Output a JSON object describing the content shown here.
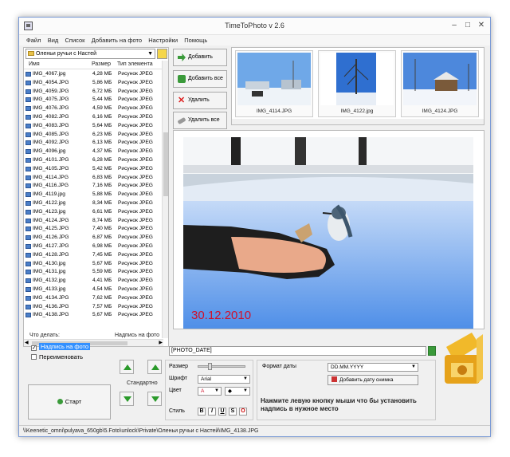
{
  "window": {
    "title": "TimeToPhoto v 2.6",
    "minimize": "–",
    "maximize": "□",
    "close": "✕"
  },
  "menu": [
    "Файл",
    "Вид",
    "Список",
    "Добавить на фото",
    "Настройки",
    "Помощь"
  ],
  "folder": {
    "current": "Оленьи ручьи с Настей"
  },
  "columns": {
    "name": "Имя",
    "size": "Размер",
    "type": "Тип элемента"
  },
  "files": [
    {
      "name": "IMG_4067.jpg",
      "size": "4,28 МБ",
      "type": "Рисунок JPEG"
    },
    {
      "name": "IMG_4054.JPG",
      "size": "5,86 МБ",
      "type": "Рисунок JPEG"
    },
    {
      "name": "IMG_4059.JPG",
      "size": "6,72 МБ",
      "type": "Рисунок JPEG"
    },
    {
      "name": "IMG_4075.JPG",
      "size": "5,44 МБ",
      "type": "Рисунок JPEG"
    },
    {
      "name": "IMG_4076.JPG",
      "size": "4,59 МБ",
      "type": "Рисунок JPEG"
    },
    {
      "name": "IMG_4082.JPG",
      "size": "6,16 МБ",
      "type": "Рисунок JPEG"
    },
    {
      "name": "IMG_4083.JPG",
      "size": "5,64 МБ",
      "type": "Рисунок JPEG"
    },
    {
      "name": "IMG_4085.JPG",
      "size": "6,23 МБ",
      "type": "Рисунок JPEG"
    },
    {
      "name": "IMG_4092.JPG",
      "size": "6,13 МБ",
      "type": "Рисунок JPEG"
    },
    {
      "name": "IMG_4096.jpg",
      "size": "4,37 МБ",
      "type": "Рисунок JPEG"
    },
    {
      "name": "IMG_4101.JPG",
      "size": "6,28 МБ",
      "type": "Рисунок JPEG"
    },
    {
      "name": "IMG_4105.JPG",
      "size": "5,42 МБ",
      "type": "Рисунок JPEG"
    },
    {
      "name": "IMG_4114.JPG",
      "size": "6,83 МБ",
      "type": "Рисунок JPEG"
    },
    {
      "name": "IMG_4116.JPG",
      "size": "7,16 МБ",
      "type": "Рисунок JPEG"
    },
    {
      "name": "IMG_4119.jpg",
      "size": "5,88 МБ",
      "type": "Рисунок JPEG"
    },
    {
      "name": "IMG_4122.jpg",
      "size": "8,34 МБ",
      "type": "Рисунок JPEG"
    },
    {
      "name": "IMG_4123.jpg",
      "size": "6,61 МБ",
      "type": "Рисунок JPEG"
    },
    {
      "name": "IMG_4124.JPG",
      "size": "8,74 МБ",
      "type": "Рисунок JPEG"
    },
    {
      "name": "IMG_4125.JPG",
      "size": "7,40 МБ",
      "type": "Рисунок JPEG"
    },
    {
      "name": "IMG_4126.JPG",
      "size": "6,87 МБ",
      "type": "Рисунок JPEG"
    },
    {
      "name": "IMG_4127.JPG",
      "size": "6,98 МБ",
      "type": "Рисунок JPEG"
    },
    {
      "name": "IMG_4128.JPG",
      "size": "7,45 МБ",
      "type": "Рисунок JPEG"
    },
    {
      "name": "IMG_4130.jpg",
      "size": "5,67 МБ",
      "type": "Рисунок JPEG"
    },
    {
      "name": "IMG_4131.jpg",
      "size": "5,59 МБ",
      "type": "Рисунок JPEG"
    },
    {
      "name": "IMG_4132.jpg",
      "size": "4,41 МБ",
      "type": "Рисунок JPEG"
    },
    {
      "name": "IMG_4133.jpg",
      "size": "4,54 МБ",
      "type": "Рисунок JPEG"
    },
    {
      "name": "IMG_4134.JPG",
      "size": "7,62 МБ",
      "type": "Рисунок JPEG"
    },
    {
      "name": "IMG_4136.JPG",
      "size": "7,57 МБ",
      "type": "Рисунок JPEG"
    },
    {
      "name": "IMG_4138.JPG",
      "size": "5,67 МБ",
      "type": "Рисунок JPEG"
    }
  ],
  "actions": {
    "add": "Добавить",
    "add_all": "Добавить все",
    "delete": "Удалить",
    "delete_all": "Удалить все"
  },
  "thumbnails": [
    "IMG_4114.JPG",
    "IMG_4122.jpg",
    "IMG_4124.JPG"
  ],
  "preview": {
    "date_stamp": "30.12.2010"
  },
  "todo": {
    "label": "Что делать:",
    "opt_stamp": "Надпись на фото",
    "opt_rename": "Переименовать"
  },
  "start_label": "Старт",
  "caption_group": "Надпись на фото",
  "arrows": {
    "standard_label": "Стандартно"
  },
  "caption_text": "[PHOTO_DATE]",
  "font": {
    "size_label": "Размер",
    "font_label": "Шрифт",
    "font_value": "Arial",
    "color_label": "Цвет",
    "style_label": "Стиль",
    "bold": "B",
    "italic": "I",
    "underline": "U",
    "shadow": "S",
    "outline": "O"
  },
  "date": {
    "format_label": "Формат даты",
    "format_value": "DD.MM.YYYY",
    "add_date_button": "Добавить дату снимка"
  },
  "hint": "Нажмите левую кнопку мыши что бы установить надпись в нужное место",
  "status": "\\\\Keenetic_omni\\pulyava_650gb\\5.Foto\\unlock\\Private\\Оленьи ручьи с Настей\\IMG_4138.JPG",
  "colors": {
    "accent": "#3390ff",
    "date_stamp": "#d0102a",
    "green": "#2a9a2a"
  }
}
